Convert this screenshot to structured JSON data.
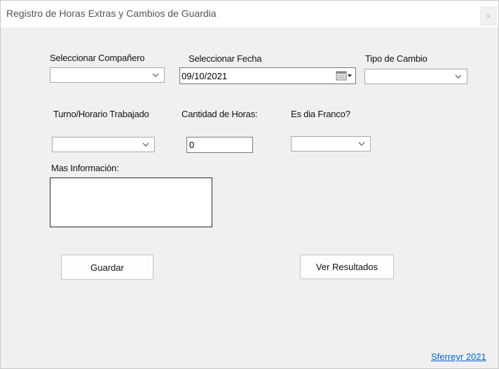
{
  "window": {
    "title": "Registro de Horas Extras y Cambios de Guardia",
    "close_glyph": "×"
  },
  "form": {
    "companero_label": "Seleccionar Compañero",
    "companero_value": "",
    "fecha_label": "Seleccionar Fecha",
    "fecha_value": "09/10/2021",
    "tipo_label": "Tipo de Cambio",
    "tipo_value": "",
    "turno_label": "Turno/Horario Trabajado",
    "turno_value": "",
    "horas_label": "Cantidad de Horas:",
    "horas_value": "0",
    "franco_label": "Es dia Franco?",
    "franco_value": "",
    "info_label": "Mas Información:",
    "info_value": ""
  },
  "buttons": {
    "guardar": "Guardar",
    "ver_resultados": "Ver Resultados"
  },
  "footer": {
    "credit_link": "Sferreyr 2021"
  },
  "icons": {
    "dropdown": "chevron-down-icon",
    "calendar": "calendar-icon",
    "close": "close-icon"
  }
}
